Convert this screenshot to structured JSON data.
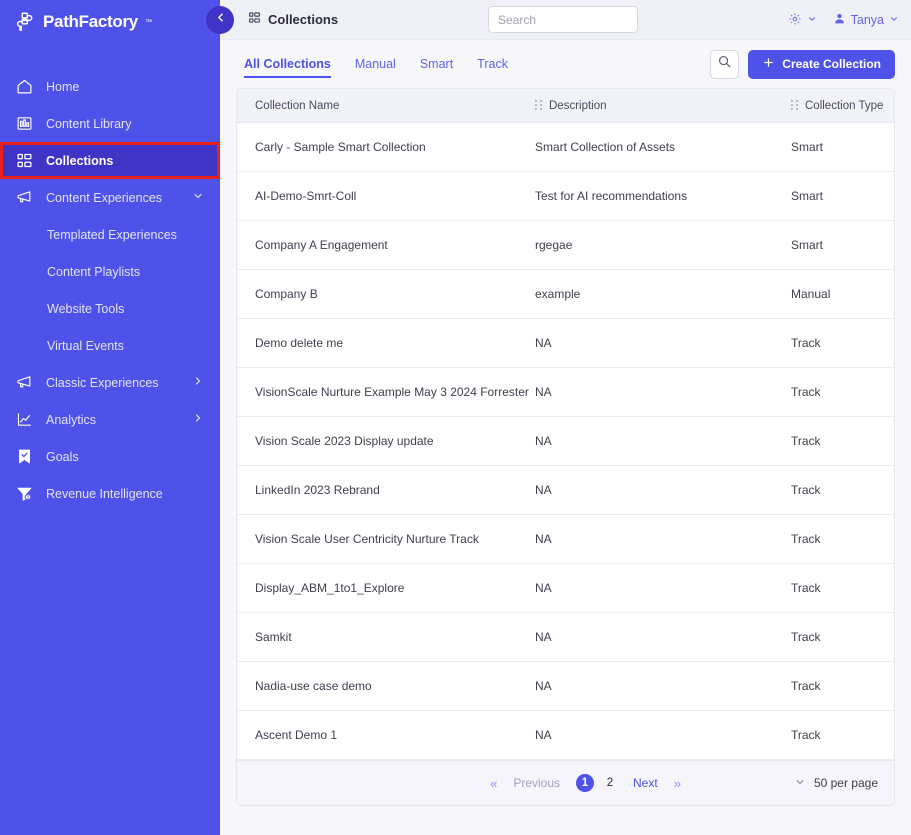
{
  "brand": {
    "name": "PathFactory",
    "trademark": "™",
    "sidebar_bg": "#4f52e8",
    "active_bg": "#3f34c6",
    "highlight_border": "#e8201f",
    "accent": "#4f52e8"
  },
  "sidebar": {
    "items": [
      {
        "label": "Home",
        "icon": "home-icon",
        "active": false,
        "sub": false,
        "chevron": ""
      },
      {
        "label": "Content Library",
        "icon": "library-icon",
        "active": false,
        "sub": false,
        "chevron": ""
      },
      {
        "label": "Collections",
        "icon": "collections-grid-icon",
        "active": true,
        "sub": false,
        "chevron": ""
      },
      {
        "label": "Content Experiences",
        "icon": "megaphone-icon",
        "active": false,
        "sub": false,
        "chevron": "chevron-down-icon"
      },
      {
        "label": "Templated Experiences",
        "icon": "",
        "active": false,
        "sub": true,
        "chevron": ""
      },
      {
        "label": "Content Playlists",
        "icon": "",
        "active": false,
        "sub": true,
        "chevron": ""
      },
      {
        "label": "Website Tools",
        "icon": "",
        "active": false,
        "sub": true,
        "chevron": ""
      },
      {
        "label": "Virtual Events",
        "icon": "",
        "active": false,
        "sub": true,
        "chevron": ""
      },
      {
        "label": "Classic Experiences",
        "icon": "megaphone-icon",
        "active": false,
        "sub": false,
        "chevron": "chevron-right-icon"
      },
      {
        "label": "Analytics",
        "icon": "chart-line-icon",
        "active": false,
        "sub": false,
        "chevron": "chevron-right-icon"
      },
      {
        "label": "Goals",
        "icon": "goal-flag-icon",
        "active": false,
        "sub": false,
        "chevron": ""
      },
      {
        "label": "Revenue Intelligence",
        "icon": "funnel-icon",
        "active": false,
        "sub": false,
        "chevron": ""
      }
    ]
  },
  "topbar": {
    "collapse_icon": "chevron-left-icon",
    "page_icon": "collections-grid-icon",
    "page_title": "Collections",
    "search_placeholder": "Search",
    "search_value": "",
    "settings_icon": "gear-icon",
    "settings_chevron": "chevron-down-icon",
    "user_icon": "user-avatar-icon",
    "user_name": "Tanya",
    "user_chevron": "chevron-down-icon"
  },
  "tabs": [
    {
      "label": "All Collections",
      "active": true
    },
    {
      "label": "Manual",
      "active": false
    },
    {
      "label": "Smart",
      "active": false
    },
    {
      "label": "Track",
      "active": false
    }
  ],
  "actions": {
    "search_icon": "search-icon",
    "create_plus_icon": "plus-icon",
    "create_label": "Create Collection"
  },
  "table": {
    "headers": [
      {
        "label": "Collection Name",
        "grip": false
      },
      {
        "label": "Description",
        "grip": true
      },
      {
        "label": "Collection Type",
        "grip": true
      }
    ],
    "rows": [
      {
        "name": "Carly - Sample Smart Collection",
        "description": "Smart Collection of Assets",
        "type": "Smart"
      },
      {
        "name": "AI-Demo-Smrt-Coll",
        "description": "Test for AI recommendations",
        "type": "Smart"
      },
      {
        "name": "Company A Engagement",
        "description": "rgegae",
        "type": "Smart"
      },
      {
        "name": "Company B",
        "description": "example",
        "type": "Manual"
      },
      {
        "name": "Demo delete me",
        "description": "NA",
        "type": "Track"
      },
      {
        "name": "VisionScale Nurture Example May 3 2024 Forrester",
        "description": "NA",
        "type": "Track"
      },
      {
        "name": "Vision Scale 2023 Display update",
        "description": "NA",
        "type": "Track"
      },
      {
        "name": "LinkedIn 2023 Rebrand",
        "description": "NA",
        "type": "Track"
      },
      {
        "name": "Vision Scale User Centricity Nurture Track",
        "description": "NA",
        "type": "Track"
      },
      {
        "name": "Display_ABM_1to1_Explore",
        "description": "NA",
        "type": "Track"
      },
      {
        "name": "Samkit",
        "description": "NA",
        "type": "Track"
      },
      {
        "name": "Nadia-use case demo",
        "description": "NA",
        "type": "Track"
      },
      {
        "name": "Ascent Demo 1",
        "description": "NA",
        "type": "Track"
      }
    ]
  },
  "pagination": {
    "first_icon": "«",
    "previous_label": "Previous",
    "pages": [
      {
        "label": "1",
        "active": true
      },
      {
        "label": "2",
        "active": false
      }
    ],
    "next_label": "Next",
    "last_icon": "»",
    "per_page_chevron": "chevron-down-icon",
    "per_page_label": "50 per page"
  }
}
